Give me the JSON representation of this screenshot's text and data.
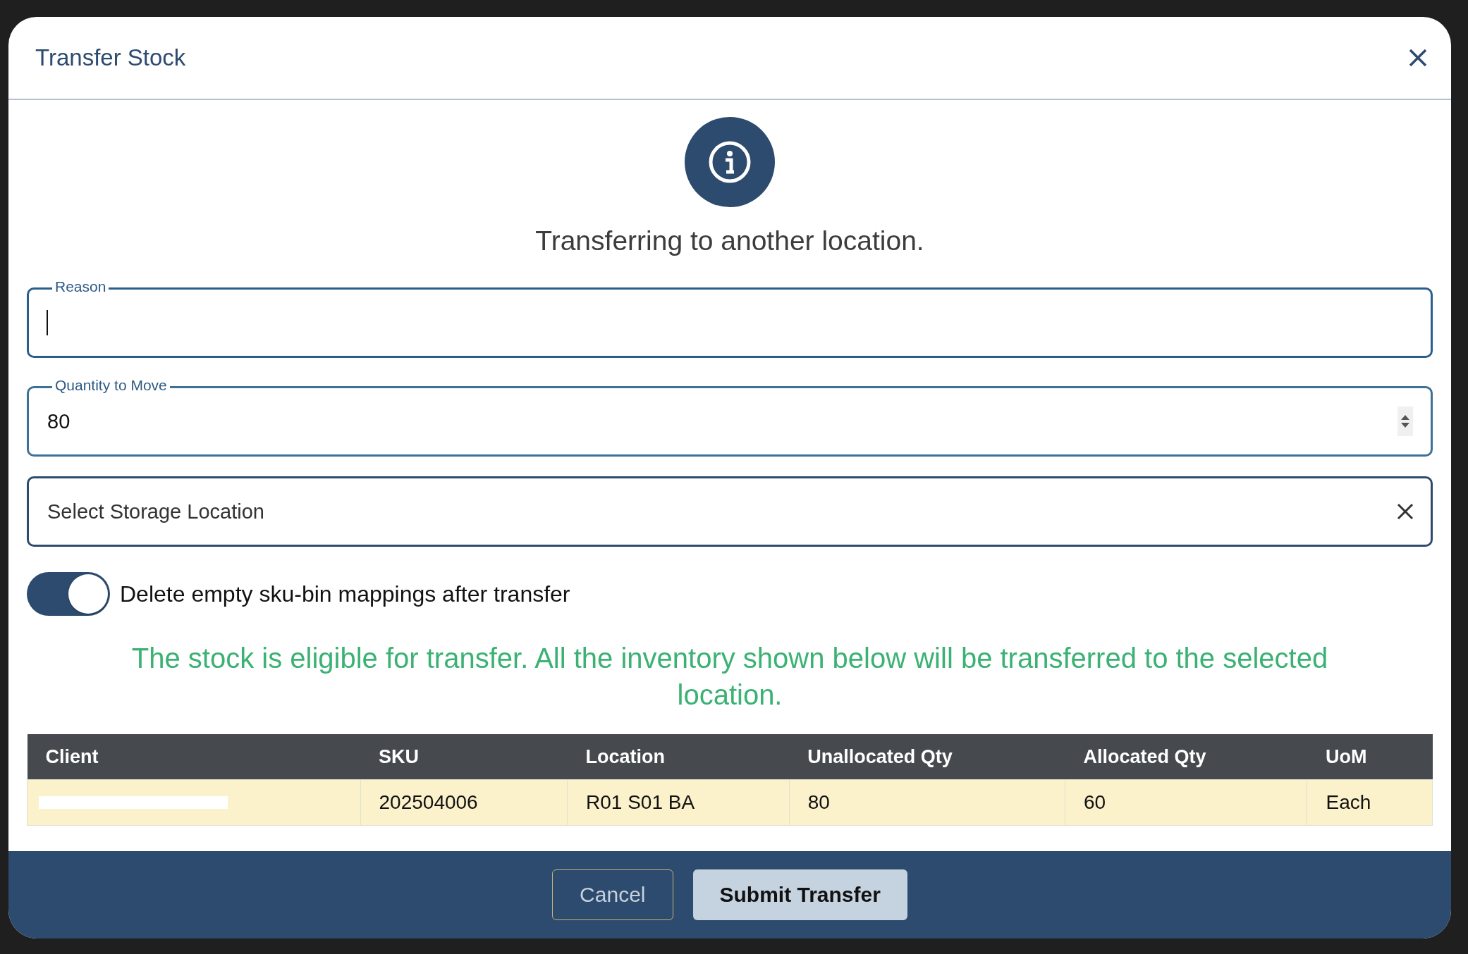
{
  "dialog": {
    "title": "Transfer Stock",
    "message": "Transferring to another location."
  },
  "fields": [
    {
      "kind": "text",
      "label": "Reason",
      "focused": true
    },
    {
      "kind": "number",
      "label": "Quantity to Move",
      "value": "80",
      "focused": false
    },
    {
      "kind": "select",
      "placeholder": "Select Storage Location"
    }
  ],
  "toggle": {
    "label": "Delete empty sku-bin mappings after transfer",
    "on": true
  },
  "notice": "The stock is eligible for transfer. All the inventory shown below will be transferred to the selected location.",
  "table": {
    "columns": [
      "Client",
      "SKU",
      "Location",
      "Unallocated Qty",
      "Allocated Qty",
      "UoM"
    ],
    "rows": [
      {
        "cells": [
          {
            "redacted": true
          },
          {
            "text": "202504006"
          },
          {
            "text": "R01 S01 BA"
          },
          {
            "text": "80"
          },
          {
            "text": "60"
          },
          {
            "text": "Each"
          }
        ]
      }
    ]
  },
  "buttons": [
    {
      "kind": "secondary",
      "label": "Cancel"
    },
    {
      "kind": "primary",
      "label": "Submit Transfer"
    }
  ]
}
